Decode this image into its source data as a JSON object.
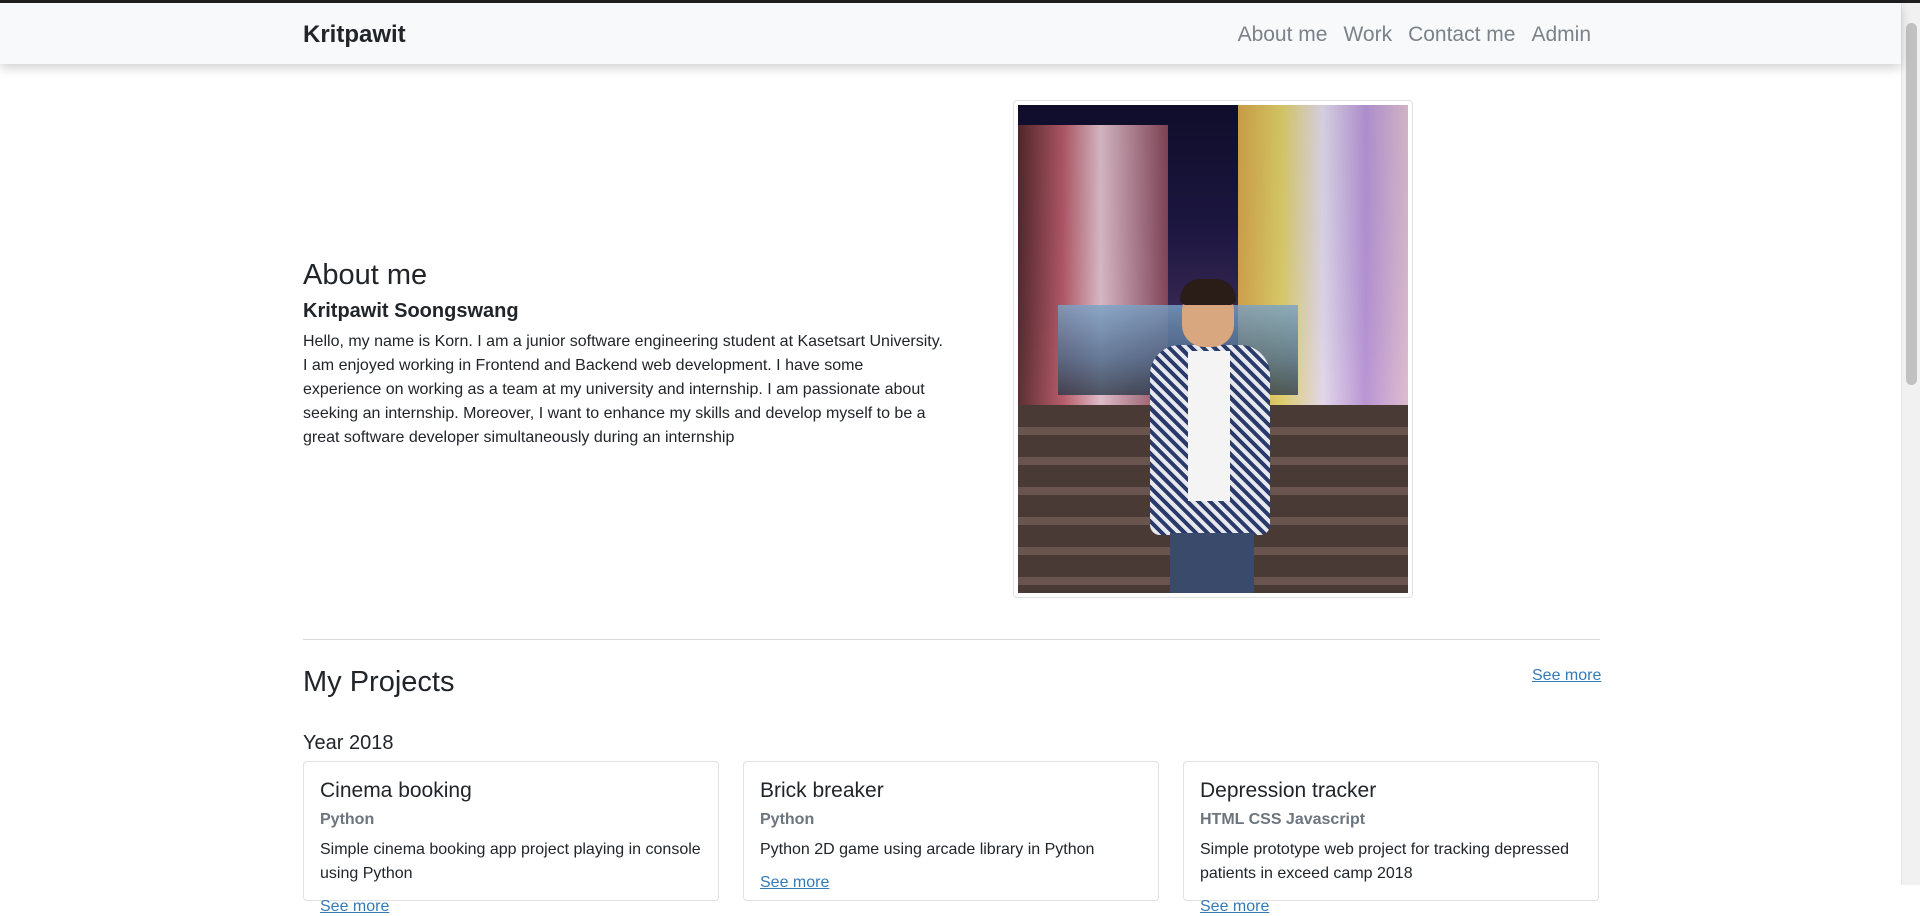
{
  "navbar": {
    "brand": "Kritpawit",
    "links": [
      "About me",
      "Work",
      "Contact me",
      "Admin"
    ]
  },
  "about": {
    "title": "About me",
    "name": "Kritpawit Soongswang",
    "text": "Hello, my name is Korn. I am a junior software engineering student at Kasetsart University. I am enjoyed working in Frontend and Backend web development. I have some experience on working as a team at my university and internship. I am passionate about seeking an internship. Moreover, I want to enhance my skills and develop myself to be a great software developer simultaneously during an internship"
  },
  "projects": {
    "title": "My Projects",
    "see_more": "See more",
    "year": "Year 2018",
    "cards": [
      {
        "title": "Cinema booking",
        "tech": "Python",
        "description": "Simple cinema booking app project playing in console using Python",
        "link": "See more"
      },
      {
        "title": "Brick breaker",
        "tech": "Python",
        "description": "Python 2D game using arcade library in Python",
        "link": "See more"
      },
      {
        "title": "Depression tracker",
        "tech": "HTML CSS Javascript",
        "description": "Simple prototype web project for tracking depressed patients in exceed camp 2018",
        "link": "See more"
      }
    ]
  },
  "colors": {
    "navbar_bg": "#f8f9fa",
    "link": "#337ab7",
    "muted": "#6c757d",
    "text": "#212529"
  }
}
